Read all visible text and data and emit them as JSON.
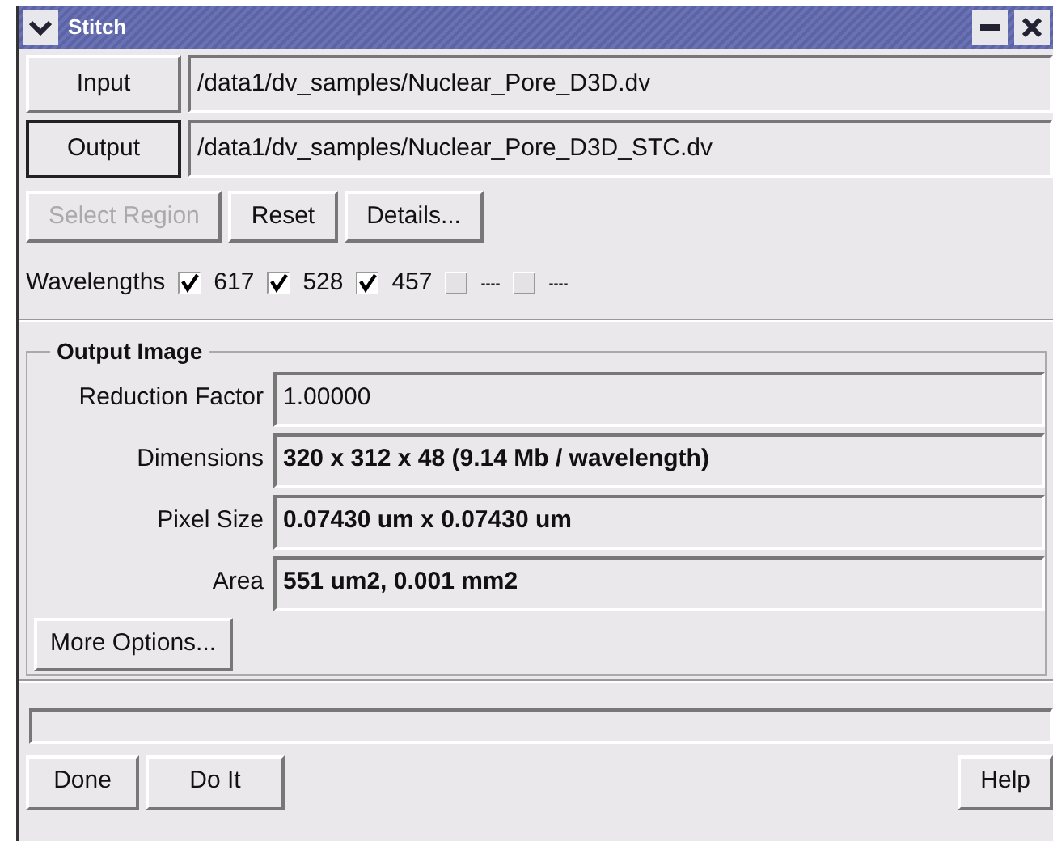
{
  "window": {
    "title": "Stitch"
  },
  "files": [
    {
      "label": "Input",
      "value": "/data1/dv_samples/Nuclear_Pore_D3D.dv",
      "focused": false
    },
    {
      "label": "Output",
      "value": "/data1/dv_samples/Nuclear_Pore_D3D_STC.dv",
      "focused": true
    }
  ],
  "actions": [
    {
      "label": "Select Region",
      "disabled": true
    },
    {
      "label": "Reset",
      "disabled": false
    },
    {
      "label": "Details...",
      "disabled": false
    }
  ],
  "wavelengths": {
    "label": "Wavelengths",
    "items": [
      {
        "label": "617",
        "checked": true
      },
      {
        "label": "528",
        "checked": true
      },
      {
        "label": "457",
        "checked": true
      },
      {
        "label": "----",
        "checked": false
      },
      {
        "label": "----",
        "checked": false
      }
    ]
  },
  "output_image": {
    "title": "Output Image",
    "fields": [
      {
        "label": "Reduction Factor",
        "value": "1.00000",
        "kind": "input"
      },
      {
        "label": "Dimensions",
        "value": "320 x 312 x 48 (9.14 Mb / wavelength)",
        "kind": "readout"
      },
      {
        "label": "Pixel Size",
        "value": "0.07430 um x 0.07430 um",
        "kind": "readout"
      },
      {
        "label": "Area",
        "value": "551 um2, 0.001 mm2",
        "kind": "readout"
      }
    ],
    "more_button": "More Options..."
  },
  "progress": {
    "level": 0
  },
  "left_buttons": [
    "Done",
    "Do It"
  ],
  "right_buttons": [
    "Help"
  ]
}
